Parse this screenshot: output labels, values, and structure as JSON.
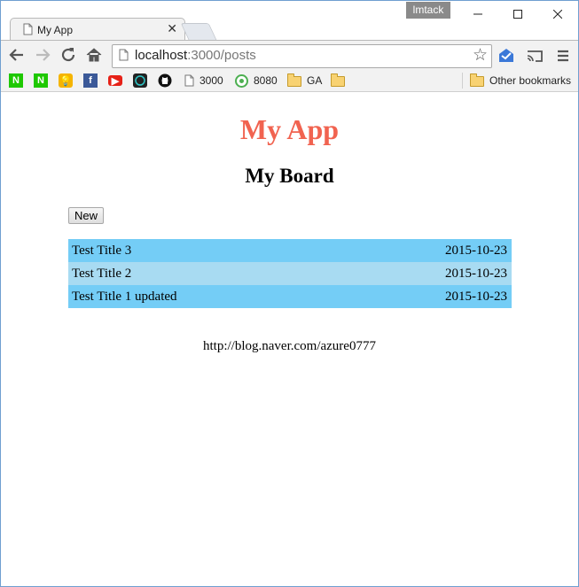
{
  "browser": {
    "tab_title": "My App",
    "user": "lmtack",
    "url_host": "localhost",
    "url_path": ":3000/posts",
    "bookmarks": [
      {
        "icon": "naver-n-green-icon"
      },
      {
        "icon": "naver-n-green-icon"
      },
      {
        "icon": "lightbulb-icon"
      },
      {
        "icon": "facebook-icon"
      },
      {
        "icon": "youtube-icon"
      },
      {
        "icon": "app-circle-icon"
      },
      {
        "icon": "github-icon"
      },
      {
        "icon": "page-icon",
        "label": "3000"
      },
      {
        "icon": "q-icon",
        "label": "8080"
      },
      {
        "icon": "folder-icon",
        "label": "GA"
      },
      {
        "icon": "folder-icon"
      }
    ],
    "other_bookmarks": "Other bookmarks"
  },
  "page": {
    "app_title": "My App",
    "board_title": "My Board",
    "new_button": "New",
    "posts": [
      {
        "title": "Test Title 3",
        "date": "2015-10-23"
      },
      {
        "title": "Test Title 2",
        "date": "2015-10-23"
      },
      {
        "title": "Test Title 1 updated",
        "date": "2015-10-23"
      }
    ],
    "footer": "http://blog.naver.com/azure0777"
  },
  "colors": {
    "app_title": "#f16350",
    "row_odd": "#74cdf6",
    "row_even": "#a8dbf2"
  }
}
